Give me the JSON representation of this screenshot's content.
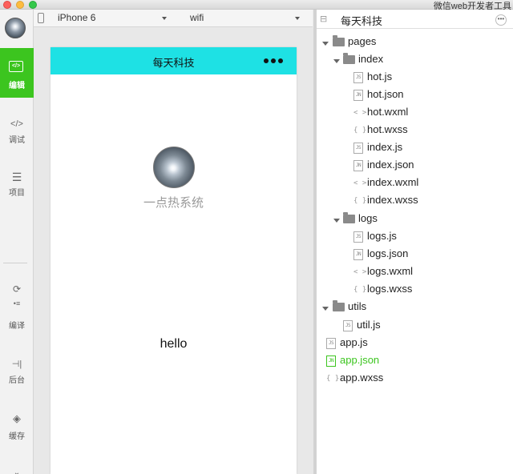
{
  "window": {
    "title": "微信web开发者工具"
  },
  "sidebar": {
    "items": [
      {
        "label": "编辑",
        "icon": "edit-icon",
        "active": true
      },
      {
        "label": "调试",
        "icon": "debug-code-icon"
      },
      {
        "label": "项目",
        "icon": "project-list-icon"
      },
      {
        "label": "编译",
        "icon": "compile-icon"
      },
      {
        "label": "后台",
        "icon": "backend-icon"
      },
      {
        "label": "缓存",
        "icon": "cache-layers-icon"
      }
    ]
  },
  "toolbar": {
    "device": "iPhone 6",
    "network": "wifi"
  },
  "simulator": {
    "nav_title": "每天科技",
    "nav_color": "#1ee1e4",
    "user_name": "一点热系统",
    "body_text": "hello"
  },
  "file_panel": {
    "title": "每天科技",
    "tree": {
      "pages": "pages",
      "index": "index",
      "index_files": [
        "hot.js",
        "hot.json",
        "hot.wxml",
        "hot.wxss",
        "index.js",
        "index.json",
        "index.wxml",
        "index.wxss"
      ],
      "logs": "logs",
      "logs_files": [
        "logs.js",
        "logs.json",
        "logs.wxml",
        "logs.wxss"
      ],
      "utils": "utils",
      "utils_files": [
        "util.js"
      ],
      "root_files": [
        "app.js",
        "app.json",
        "app.wxss"
      ]
    },
    "file_badges": {
      "js": "JS",
      "json": "JN",
      "wxml": "< >",
      "wxss": "{ }"
    },
    "selected_color": "#3cc51f"
  }
}
